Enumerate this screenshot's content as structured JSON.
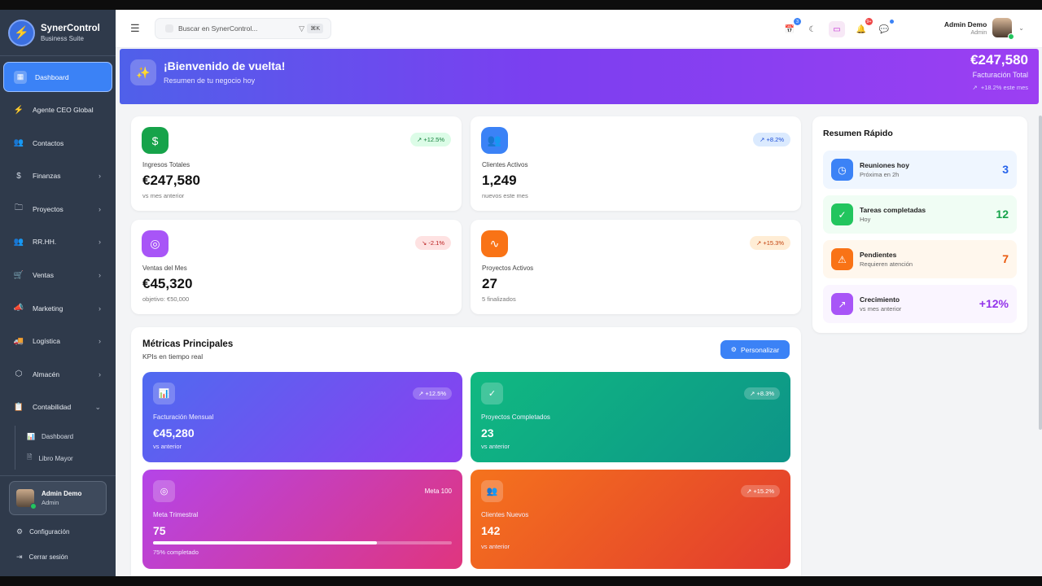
{
  "brand": {
    "name": "SynerControl",
    "subtitle": "Business Suite"
  },
  "sidebar": {
    "items": [
      {
        "label": "Dashboard",
        "icon": "grid-icon",
        "active": true
      },
      {
        "label": "Agente CEO Global",
        "icon": "bolt-icon"
      },
      {
        "label": "Contactos",
        "icon": "users-icon"
      },
      {
        "label": "Finanzas",
        "icon": "dollar-icon",
        "chevron": "›"
      },
      {
        "label": "Proyectos",
        "icon": "folder-icon",
        "chevron": "›"
      },
      {
        "label": "RR.HH.",
        "icon": "users-icon",
        "chevron": "›"
      },
      {
        "label": "Ventas",
        "icon": "cart-icon",
        "chevron": "›"
      },
      {
        "label": "Marketing",
        "icon": "megaphone-icon",
        "chevron": "›"
      },
      {
        "label": "Logística",
        "icon": "truck-icon",
        "chevron": "›"
      },
      {
        "label": "Almacén",
        "icon": "box-icon",
        "chevron": "›"
      },
      {
        "label": "Contabilidad",
        "icon": "clipboard-icon",
        "chevron": "⌄"
      }
    ],
    "subitems": [
      {
        "label": "Dashboard",
        "icon": "bar-chart-icon"
      },
      {
        "label": "Libro Mayor",
        "icon": "document-icon"
      }
    ],
    "user": {
      "name": "Admin Demo",
      "role": "Admin"
    },
    "footer": {
      "settings": "Configuración",
      "logout": "Cerrar sesión"
    }
  },
  "topbar": {
    "search_placeholder": "Buscar en SynerControl...",
    "shortcut": "⌘K",
    "calendar_badge": "3",
    "notif_badge": "9+",
    "user": {
      "name": "Admin Demo",
      "role": "Admin"
    }
  },
  "hero": {
    "title": "¡Bienvenido de vuelta!",
    "subtitle": "Resumen de tu negocio hoy",
    "amount": "€247,580",
    "amount_label": "Facturación Total",
    "growth": "+18.2% este mes"
  },
  "stats": [
    {
      "label": "Ingresos Totales",
      "value": "€247,580",
      "note": "vs mes anterior",
      "badge": "+12.5%",
      "trend": "up",
      "icon": "dollar-icon",
      "color": "#16a34a"
    },
    {
      "label": "Clientes Activos",
      "value": "1,249",
      "note": "nuevos este mes",
      "badge": "+8.2%",
      "trend": "up",
      "icon": "users-icon",
      "color": "#3b82f6"
    },
    {
      "label": "Ventas del Mes",
      "value": "€45,320",
      "note": "objetivo: €50,000",
      "badge": "-2.1%",
      "trend": "down",
      "icon": "target-icon",
      "color": "#a855f7"
    },
    {
      "label": "Proyectos Activos",
      "value": "27",
      "note": "5 finalizados",
      "badge": "+15.3%",
      "trend": "up",
      "icon": "activity-icon",
      "color": "#f97316"
    }
  ],
  "quick_summary": {
    "title": "Resumen Rápido",
    "items": [
      {
        "title": "Reuniones hoy",
        "sub": "Próxima en 2h",
        "value": "3",
        "icon": "clock-icon",
        "color": "#3b82f6"
      },
      {
        "title": "Tareas completadas",
        "sub": "Hoy",
        "value": "12",
        "icon": "check-circle-icon",
        "color": "#22c55e"
      },
      {
        "title": "Pendientes",
        "sub": "Requieren atención",
        "value": "7",
        "icon": "warning-icon",
        "color": "#f97316"
      },
      {
        "title": "Crecimiento",
        "sub": "vs mes anterior",
        "value": "+12%",
        "icon": "trending-up-icon",
        "color": "#a855f7"
      }
    ]
  },
  "metrics": {
    "title": "Métricas Principales",
    "subtitle": "KPIs en tiempo real",
    "button": "Personalizar",
    "tiles": [
      {
        "label": "Facturación Mensual",
        "value": "€45,280",
        "note": "vs anterior",
        "badge": "+12.5%",
        "icon": "bar-chart-icon"
      },
      {
        "label": "Proyectos Completados",
        "value": "23",
        "note": "vs anterior",
        "badge": "+8.3%",
        "icon": "check-circle-icon"
      },
      {
        "label": "Meta Trimestral",
        "value": "75",
        "note": "75% completado",
        "badge": "Meta 100",
        "progress": 0.75,
        "icon": "target-icon"
      },
      {
        "label": "Clientes Nuevos",
        "value": "142",
        "note": "vs anterior",
        "badge": "+15.2%",
        "icon": "users-icon"
      }
    ]
  }
}
